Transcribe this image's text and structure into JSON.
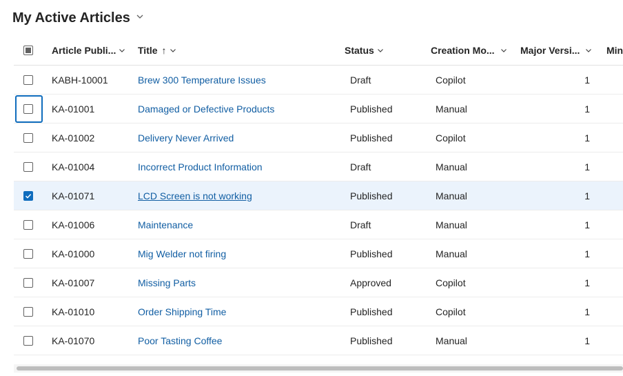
{
  "view": {
    "title": "My Active Articles"
  },
  "columns": {
    "article_number": "Article Publi...",
    "title": "Title",
    "status": "Status",
    "creation_mode": "Creation Mo...",
    "major_version": "Major Versi...",
    "minor_version": "Min"
  },
  "sort": {
    "indicator": "↑"
  },
  "rows": [
    {
      "id": "KABH-10001",
      "title": "Brew 300 Temperature Issues",
      "status": "Draft",
      "mode": "Copilot",
      "major": "1",
      "checked": false
    },
    {
      "id": "KA-01001",
      "title": "Damaged or Defective Products",
      "status": "Published",
      "mode": "Manual",
      "major": "1",
      "checked": false
    },
    {
      "id": "KA-01002",
      "title": "Delivery Never Arrived",
      "status": "Published",
      "mode": "Copilot",
      "major": "1",
      "checked": false
    },
    {
      "id": "KA-01004",
      "title": "Incorrect Product Information",
      "status": "Draft",
      "mode": "Manual",
      "major": "1",
      "checked": false
    },
    {
      "id": "KA-01071",
      "title": "LCD Screen is not working",
      "status": "Published",
      "mode": "Manual",
      "major": "1",
      "checked": true
    },
    {
      "id": "KA-01006",
      "title": "Maintenance",
      "status": "Draft",
      "mode": "Manual",
      "major": "1",
      "checked": false
    },
    {
      "id": "KA-01000",
      "title": "Mig Welder not firing",
      "status": "Published",
      "mode": "Manual",
      "major": "1",
      "checked": false
    },
    {
      "id": "KA-01007",
      "title": "Missing Parts",
      "status": "Approved",
      "mode": "Copilot",
      "major": "1",
      "checked": false
    },
    {
      "id": "KA-01010",
      "title": "Order Shipping Time",
      "status": "Published",
      "mode": "Copilot",
      "major": "1",
      "checked": false
    },
    {
      "id": "KA-01070",
      "title": "Poor Tasting Coffee",
      "status": "Published",
      "mode": "Manual",
      "major": "1",
      "checked": false
    }
  ],
  "colors": {
    "link": "#115ea3",
    "selected_row": "#ebf3fc",
    "accent": "#0f6cbd"
  }
}
